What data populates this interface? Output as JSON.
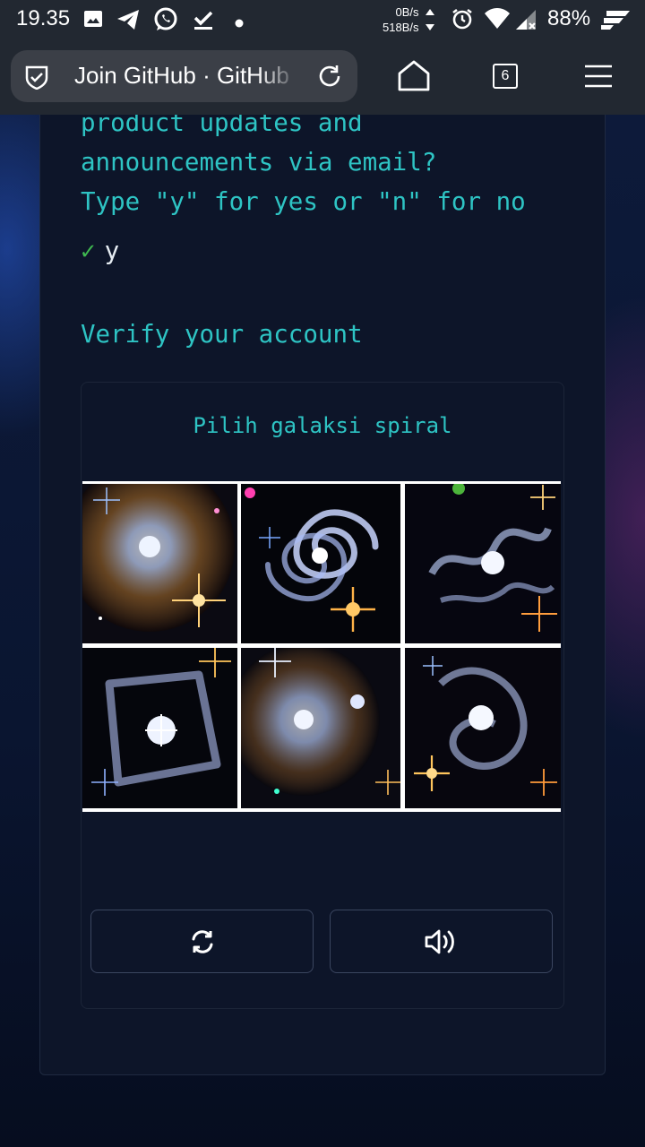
{
  "status_bar": {
    "time": "19.35",
    "net_down": "0B/s",
    "net_up": "518B/s",
    "battery": "88%"
  },
  "browser": {
    "tab_title": "Join GitHub · GitHub",
    "tab_count": "6"
  },
  "terminal": {
    "lines": [
      "product updates and",
      "announcements via email?",
      "Type \"y\" for yes or \"n\" for no"
    ],
    "answer": "y",
    "check_mark": "✓",
    "verify_heading": "Verify your account"
  },
  "captcha": {
    "prompt": "Pilih galaksi spiral",
    "tiles": [
      {
        "name": "galaxy-tile-1",
        "kind": "elliptical"
      },
      {
        "name": "galaxy-tile-2",
        "kind": "spiral"
      },
      {
        "name": "galaxy-tile-3",
        "kind": "irregular"
      },
      {
        "name": "galaxy-tile-4",
        "kind": "ring"
      },
      {
        "name": "galaxy-tile-5",
        "kind": "elliptical"
      },
      {
        "name": "galaxy-tile-6",
        "kind": "irregular"
      }
    ],
    "buttons": {
      "refresh_icon": "refresh-icon",
      "audio_icon": "speaker-icon"
    }
  },
  "colors": {
    "accent_cyan": "#2ec4c4",
    "check_green": "#3fb950",
    "card_bg": "#0d1529"
  }
}
